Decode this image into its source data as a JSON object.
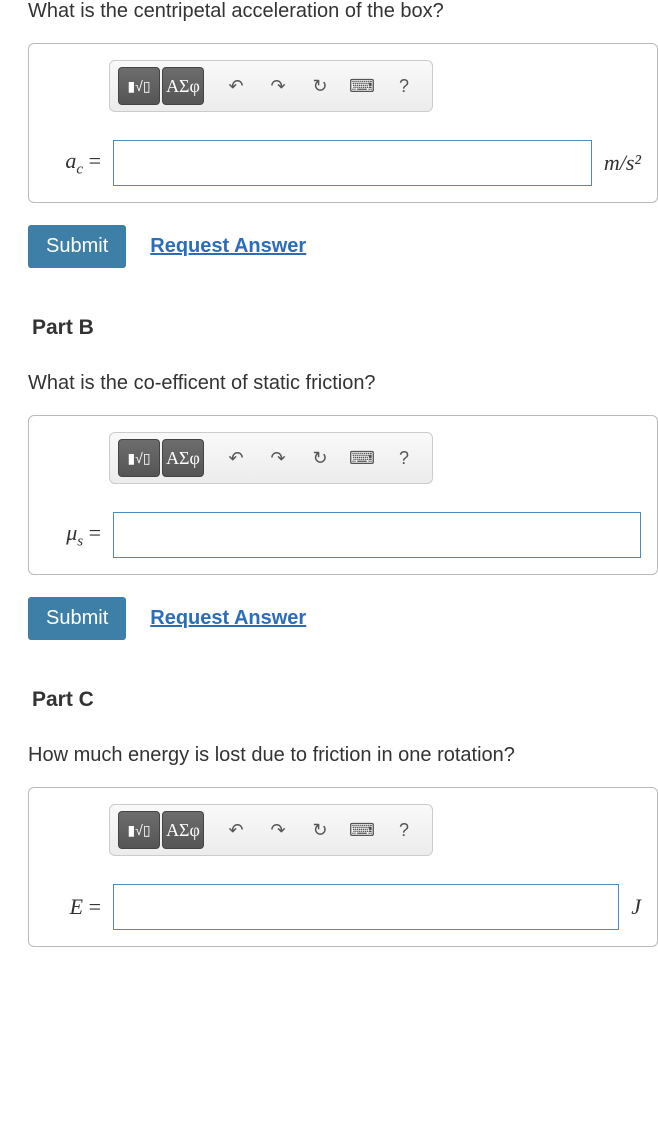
{
  "partA": {
    "question": "What is the centripetal acceleration of the box?",
    "varLabel": "a",
    "varSub": "c",
    "equals": " = ",
    "unit": "m/s²",
    "value": ""
  },
  "partB": {
    "header": "Part B",
    "question": "What is the co-efficent of static friction?",
    "varLabel": "μ",
    "varSub": "s",
    "equals": " = ",
    "unit": "",
    "value": ""
  },
  "partC": {
    "header": "Part C",
    "question": "How much energy is lost due to friction in one rotation?",
    "varLabel": "E",
    "varSub": "",
    "equals": " = ",
    "unit": "J",
    "value": ""
  },
  "toolbar": {
    "templateBtn": "▮√▯",
    "greekBtn": "ΑΣφ",
    "undo": "↶",
    "redo": "↷",
    "reset": "↻",
    "keyboard": "⌨",
    "help": "?"
  },
  "buttons": {
    "submit": "Submit",
    "requestAnswer": "Request Answer"
  }
}
